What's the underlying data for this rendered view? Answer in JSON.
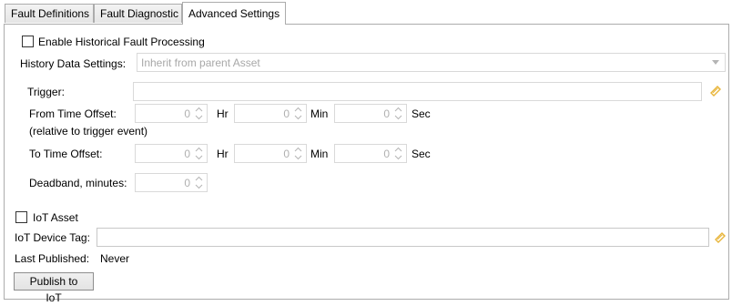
{
  "tabs": [
    {
      "label": "Fault Definitions"
    },
    {
      "label": "Fault Diagnostic"
    },
    {
      "label": "Advanced Settings"
    }
  ],
  "historical": {
    "checkbox_label": "Enable Historical Fault Processing",
    "history_label": "History Data Settings:",
    "history_value": "Inherit from parent Asset"
  },
  "trigger": {
    "label": "Trigger:",
    "from_label": "From Time Offset:",
    "from_note": "(relative to trigger event)",
    "to_label": "To Time Offset:",
    "deadband_label": "Deadband, minutes:",
    "hr_label": "Hr",
    "min_label": "Min",
    "sec_label": "Sec",
    "from_hr": "0",
    "from_min": "0",
    "from_sec": "0",
    "to_hr": "0",
    "to_min": "0",
    "to_sec": "0",
    "deadband": "0"
  },
  "iot": {
    "checkbox_label": "IoT Asset",
    "device_tag_label": "IoT Device Tag:",
    "last_published_label": "Last Published:",
    "last_published_value": "Never",
    "publish_button": "Publish to IoT"
  },
  "icons": {
    "trigger_picker": "tag-pencil-icon",
    "device_tag_picker": "tag-pencil-icon",
    "dropdown": "chevron-down-icon",
    "spinner": "spin-arrows-icon"
  },
  "colors": {
    "border": "#acacac",
    "disabled_text": "#9a9a9a",
    "field_border": "#d9d9d9",
    "icon_accent": "#e8b53a"
  }
}
